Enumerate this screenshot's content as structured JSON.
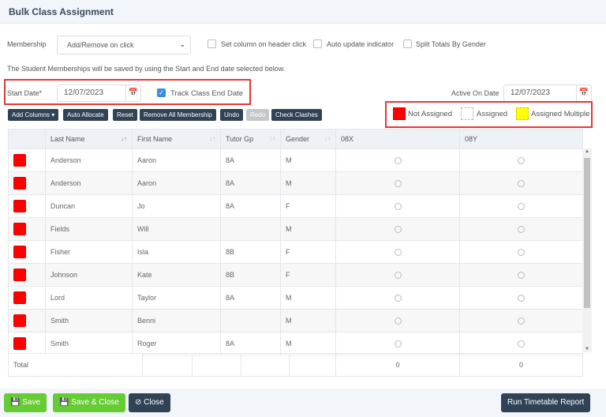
{
  "title": "Bulk Class Assignment",
  "membership": {
    "label": "Membership",
    "value": "Add/Remove on click"
  },
  "options": [
    {
      "label": "Set column on header click",
      "checked": false
    },
    {
      "label": "Auto update indicator",
      "checked": false
    },
    {
      "label": "Split Totals By Gender",
      "checked": false
    }
  ],
  "info_text": "The Student Memberships will be saved by using the Start and End date selected below.",
  "start_date": {
    "label": "Start Date*",
    "value": "12/07/2023"
  },
  "track_end": {
    "label": "Track Class End Date",
    "checked": true
  },
  "active_on": {
    "label": "Active On Date",
    "value": "12/07/2023"
  },
  "toolbar": {
    "add_columns": "Add Columns",
    "auto_allocate": "Auto Allocate",
    "reset": "Reset",
    "remove_all": "Remove All Membership",
    "undo": "Undo",
    "redo": "Redo",
    "check_clashes": "Check Clashes"
  },
  "legend": {
    "not_assigned": "Not Assigned",
    "assigned": "Assigned",
    "assigned_multiple": "Assigned Multiple",
    "colors": {
      "not_assigned": "#ff0000",
      "assigned": "#ffffff",
      "assigned_multiple": "#ffff00"
    }
  },
  "table": {
    "headers": [
      "Last Name",
      "First Name",
      "Tutor Gp",
      "Gender",
      "08X",
      "08Y"
    ],
    "rows": [
      [
        "Anderson",
        "Aaron",
        "8A",
        "M"
      ],
      [
        "Anderson",
        "Aaron",
        "8A",
        "M"
      ],
      [
        "Duncan",
        "Jo",
        "8A",
        "F"
      ],
      [
        "Fields",
        "Will",
        "",
        "M"
      ],
      [
        "Fisher",
        "Isla",
        "8B",
        "F"
      ],
      [
        "Johnson",
        "Kate",
        "8B",
        "F"
      ],
      [
        "Lord",
        "Taylor",
        "8A",
        "M"
      ],
      [
        "Smith",
        "Benni",
        "",
        "M"
      ],
      [
        "Smith",
        "Roger",
        "8A",
        "M"
      ]
    ],
    "total_label": "Total",
    "totals": [
      "0",
      "0"
    ]
  },
  "footer": {
    "save": "Save",
    "save_close": "Save & Close",
    "close": "Close",
    "run_report": "Run Timetable Report"
  }
}
